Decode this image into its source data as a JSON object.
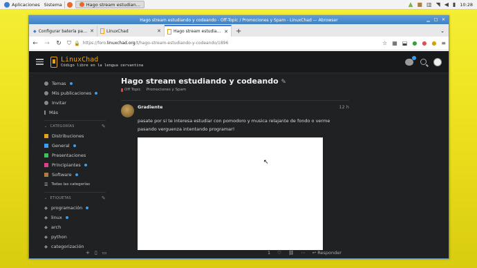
{
  "system_panel": {
    "apps_menu": "Aplicaciones",
    "system_menu": "Sistema",
    "task_title": "Hago stream estudian...",
    "clock": "10:28"
  },
  "window": {
    "title": "Hago stream estudiando y codeando - Off-Topic / Promociones y Spam - LinuxChad — Abrowser"
  },
  "tabs": [
    {
      "title": "Configurar batería para el apag",
      "active": false
    },
    {
      "title": "LinuxChad",
      "active": false
    },
    {
      "title": "Hago stream estudiando y codi",
      "active": true
    }
  ],
  "address": {
    "prefix": "https://foro.",
    "domain": "linuxchad.org",
    "path": "/t/hago-stream-estudiando-y-codeando/1896"
  },
  "site": {
    "name": "LinuxChad",
    "tagline": "Código libre en la lengua cervantina"
  },
  "sidebar": {
    "items": [
      {
        "label": "Temas",
        "dot": true
      },
      {
        "label": "Mis publicaciones",
        "dot": true
      },
      {
        "label": "Invitar",
        "dot": false
      },
      {
        "label": "Más",
        "dot": false
      }
    ],
    "categories_header": "CATEGORÍAS",
    "categories": [
      {
        "label": "Distribuciones",
        "color": "#e8a020",
        "dot": false
      },
      {
        "label": "General",
        "color": "#3a9ff0",
        "dot": true
      },
      {
        "label": "Presentaciones",
        "color": "#40c060",
        "dot": false
      },
      {
        "label": "Principiantes",
        "color": "#e0408a",
        "dot": true
      },
      {
        "label": "Software",
        "color": "#b07b40",
        "dot": true
      }
    ],
    "all_categories": "Todas las categorías",
    "tags_header": "ETIQUETAS",
    "tags": [
      {
        "label": "programación",
        "dot": true
      },
      {
        "label": "linux",
        "dot": true
      },
      {
        "label": "arch",
        "dot": false
      },
      {
        "label": "python",
        "dot": false
      },
      {
        "label": "categorización",
        "dot": false
      }
    ]
  },
  "topic": {
    "title": "Hago stream estudiando y codeando",
    "category": "Off Topic",
    "subcategory": "Promociones y Spam",
    "post": {
      "author": "Gradiente",
      "age": "12 h",
      "text": "pasate por si te interesa estudiar con pomodoro y musica relajante de fondo o verme pasando verguenza intentando programar!",
      "likes": "1",
      "reply_label": "Responder"
    }
  }
}
